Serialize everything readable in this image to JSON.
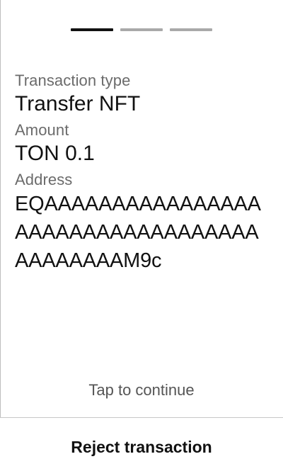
{
  "progress": {
    "steps": 3,
    "current": 1
  },
  "details": {
    "type_label": "Transaction type",
    "type_value": "Transfer NFT",
    "amount_label": "Amount",
    "amount_value": "TON 0.1",
    "address_label": "Address",
    "address_value": "EQAAAAAAAAAAAAAAAAAAAAAAAAAAAAAAAAAAAAAAAAAAM9c"
  },
  "footer": {
    "tap_hint": "Tap to continue",
    "reject_label": "Reject transaction"
  },
  "colors": {
    "progress_active": "#111111",
    "progress_inactive": "#a9a9a9",
    "label_text": "#6b6b6b",
    "value_text": "#111111"
  }
}
